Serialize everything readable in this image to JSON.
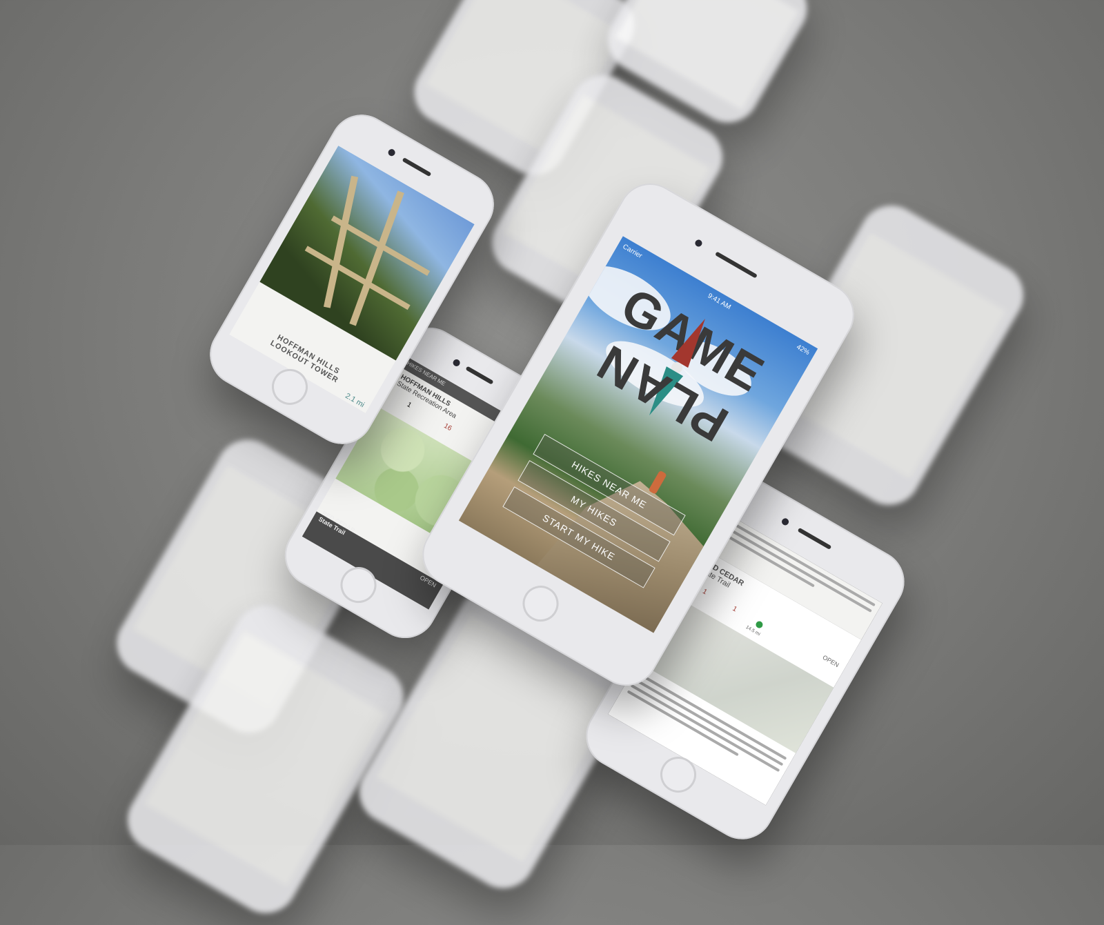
{
  "background_color": "#7b7b79",
  "main_phone": {
    "status": {
      "carrier": "Carrier",
      "time": "9:41 AM",
      "battery": "42%"
    },
    "logo": {
      "line1": "GAME",
      "line2": "PLAN"
    },
    "menu": [
      {
        "label": "HIKES NEAR ME"
      },
      {
        "label": "MY HIKES"
      },
      {
        "label": "START MY HIKE"
      }
    ],
    "accent_red": "#a3372e",
    "accent_teal": "#2b8e86"
  },
  "tower_phone": {
    "title_line1": "HOFFMAN HILLS",
    "title_line2": "LOOKOUT TOWER",
    "distance": "2.1 mi"
  },
  "hoffman_phone": {
    "header": "HIKES NEAR ME",
    "title_line1": "HOFFMAN HILLS",
    "title_line2": "State Recreation Area",
    "landmarks": "1",
    "trails": "16",
    "footer_line1": "RED CEDAR",
    "footer_line2": "State Trail",
    "status": "OPEN"
  },
  "cedar_phone": {
    "title_line1": "RED CEDAR",
    "title_line2": "State Trail",
    "landmarks": "1",
    "trails": "1",
    "distance": "14.5 mi",
    "status": "OPEN"
  }
}
